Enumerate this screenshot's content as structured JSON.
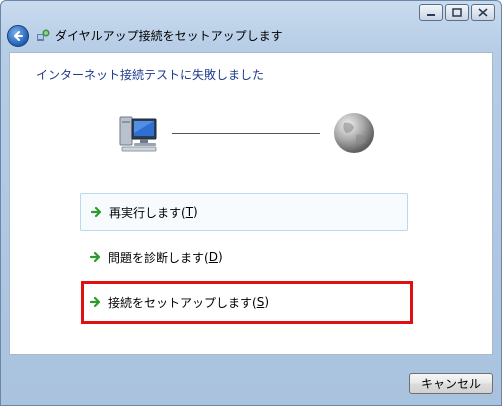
{
  "window": {
    "title": "ダイヤルアップ接続をセットアップします",
    "buttons": {
      "minimize": "minimize-icon",
      "maximize": "maximize-icon",
      "close": "close-icon"
    }
  },
  "main": {
    "heading": "インターネット接続テストに失敗しました",
    "options": [
      {
        "label_pre": "再実行します(",
        "key": "T",
        "label_post": ")"
      },
      {
        "label_pre": "問題を診断します(",
        "key": "D",
        "label_post": ")"
      },
      {
        "label_pre": "接続をセットアップします(",
        "key": "S",
        "label_post": ")"
      }
    ]
  },
  "footer": {
    "cancel_label": "キャンセル"
  },
  "colors": {
    "heading": "#1e3a8a",
    "highlight": "#e10f0f",
    "arrow": "#2e9b2e"
  }
}
